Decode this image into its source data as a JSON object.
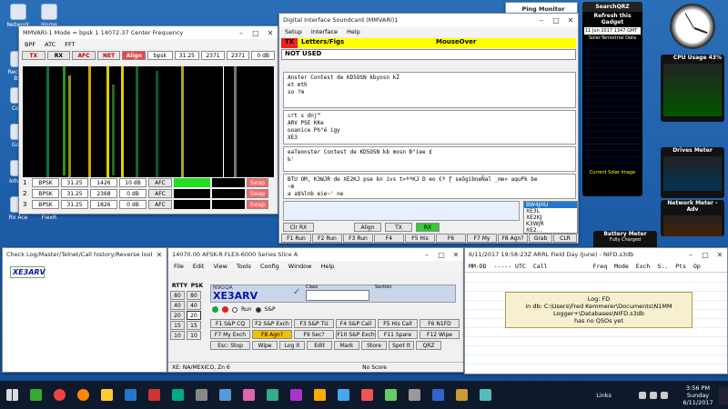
{
  "desktop": {
    "icons": [
      "Network",
      "Home GW",
      "Recycle Bin",
      "Cont",
      "Gate",
      "Iotwall",
      "Rx Ace",
      "Isolo",
      "Salo",
      "FlexR"
    ],
    "gadget_refresh": {
      "title": "Refresh this Gadget",
      "callsign": "SearchQRZ",
      "date": "11 Jun 2017 1347 GMT",
      "subtitle": "Solar-Terrestrial Data",
      "footer": "Current Solar Image"
    },
    "cpu": {
      "label": "CPU Usage 43%"
    },
    "drives": {
      "label": "Drives Meter"
    },
    "network": {
      "label": "Network Meter - Adv"
    },
    "battery": {
      "label": "Battery Meter",
      "status": "Fully Charged"
    }
  },
  "mmvari": {
    "title": "MMVARI-1 Mode = bpsk 1 14072.37 Center Frequency",
    "menu": [
      "BPF",
      "ATC",
      "FFT"
    ],
    "toolbar": {
      "tx": "TX",
      "rx": "RX",
      "afc": "AFC",
      "net": "NET",
      "align": "Align",
      "mode": "bpsk",
      "speed": "31.25",
      "f1": "2371",
      "f2": "2371",
      "db": "0 dB"
    },
    "channels": [
      {
        "n": "1",
        "mode": "BPSK",
        "speed": "31.25",
        "freq": "1426",
        "db": "10 dB",
        "afc": "AFC",
        "swap": "Swap"
      },
      {
        "n": "2",
        "mode": "BPSK",
        "speed": "31.25",
        "freq": "2368",
        "db": "0 dB",
        "afc": "AFC",
        "swap": "Swap"
      },
      {
        "n": "3",
        "mode": "BPSK",
        "speed": "31.25",
        "freq": "1826",
        "db": "0 dB",
        "afc": "AFC",
        "swap": "Swap"
      }
    ]
  },
  "ping": {
    "title": "Ping Monitor"
  },
  "dis": {
    "title": "Digital Interface Soundcard (MMVARI)1",
    "menu": [
      "Setup",
      "Interface",
      "Help"
    ],
    "tx": "TX",
    "letters": "Letters/Figs",
    "mouseover": "MouseOver",
    "notused": "NOT USED",
    "pane1": [
      "Anster Contest de KD5OSN  kbyosn  kŽ",
      "et mth",
      "so ?m"
    ],
    "pane2": [
      "crt s dnj™",
      "ARV  PSE  KKe",
      "ooanice Ph°ê  igy",
      "XE3"
    ],
    "pane3": [
      " eaTeonster Contest de KD5OSN  kb mosn  Ð°iee   £",
      " ‰'"
    ],
    "pane4": [
      "BTU OM, K3WJR de  XE2KJ pse kn  ivs t>ªªKJ  D   eo  €ª ƒ seõgibneÑal _me» aquPk be",
      "~m",
      "a a$%lnb eie~' ne"
    ],
    "calls": [
      "BW4JHU",
      "XE3L",
      "XE2KJ",
      "K3WJR",
      "XE2..."
    ],
    "buttons_row1": [
      "Clr RX",
      "Align",
      "TX",
      "RX"
    ],
    "buttons_row2": [
      "F1 Run",
      "F2 Run",
      "F3 Run",
      "F4",
      "F5 His",
      "F6",
      "F7 My",
      "F8 Agn?",
      "Grab",
      "CLR"
    ]
  },
  "check": {
    "title": "Check Log/Master/Telnet/Call history/Reverse lookup",
    "call": "XE3ARV"
  },
  "entry": {
    "title": "14070.00 AFSK-R FLEX-6000 Series Slice A",
    "menu": [
      "File",
      "Edit",
      "View",
      "Tools",
      "Config",
      "Window",
      "Help"
    ],
    "rtty_label": "RTTY",
    "psk_label": "PSK",
    "rtty": [
      "80",
      "40",
      "20",
      "15",
      "10"
    ],
    "psk": [
      "80",
      "40",
      "20",
      "15",
      "10"
    ],
    "prev_call": "N9GQA",
    "call": "XE3ARV",
    "class_label": "Class",
    "section_label": "Section",
    "run": "Run",
    "sp": "S&P",
    "fkeys": [
      [
        "F1 S&P CQ",
        "F2 S&P Exch",
        "F3 S&P TU",
        "F4 S&P Call",
        "F5 His Call",
        "F6 N1FD"
      ],
      [
        "F7 My Exch",
        "F8 Agn?",
        "F9 Sec?",
        "F10 S&P Exch",
        "F11 Spare",
        "F12 Wipe"
      ],
      [
        "Esc: Stop",
        "Wipe",
        "Log it",
        "Edit",
        "Mark",
        "Store",
        "Spot It",
        "QRZ"
      ]
    ],
    "status_left": "XE: NA/MEXICO, Zn 6",
    "status_right": "No Score"
  },
  "log": {
    "title": "6/11/2017 19:58:23Z  ARRL Field Day (June) - NIFD.s3db",
    "headers": [
      "MM-DD",
      "----- UTC",
      "Call",
      "Freq",
      "Mode",
      "Exch",
      "S..",
      "Pts",
      "Op"
    ],
    "msg1": "Log: FD",
    "msg2": "in db: C:\\Users\\Fred Kemmerer\\Documents\\N1MM Logger+\\Databases\\NIFD.s3db",
    "msg3": "has no QSOs yet"
  },
  "taskbar": {
    "links": "Links",
    "time": "3:56 PM",
    "day": "Sunday",
    "date": "6/11/2017"
  }
}
